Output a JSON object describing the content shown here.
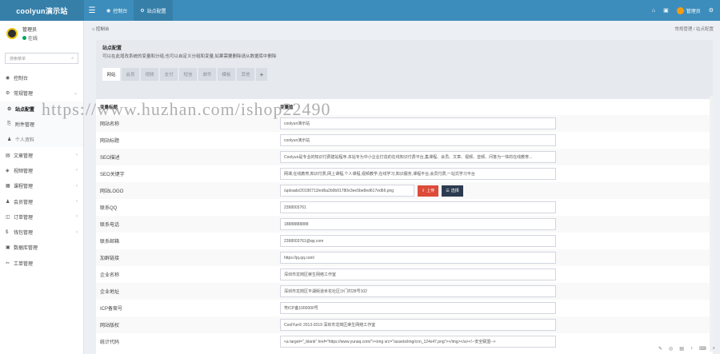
{
  "brand": "coolyun演示站",
  "topnav": [
    {
      "icon": "dashboard-icon",
      "label": "控制台",
      "active": false
    },
    {
      "icon": "gear-icon",
      "label": "站点配置",
      "active": true
    }
  ],
  "topright": {
    "user_name": "管理员"
  },
  "sidebar": {
    "user": {
      "name": "管理员",
      "status": "在线"
    },
    "search_placeholder": "搜索菜单",
    "items": [
      {
        "icon": "dashboard-icon",
        "label": "控制台",
        "type": "top"
      },
      {
        "icon": "cogs-icon",
        "label": "常规管理",
        "type": "top",
        "arrow": "⌄"
      },
      {
        "icon": "gear-icon",
        "label": "站点配置",
        "type": "sub active"
      },
      {
        "icon": "paperclip-icon",
        "label": "附件管理",
        "type": "sub"
      },
      {
        "icon": "user-icon",
        "label": "个人资料",
        "type": "sub dim"
      },
      {
        "icon": "book-icon",
        "label": "文章管理",
        "type": "top",
        "arrow": "‹"
      },
      {
        "icon": "bag-icon",
        "label": "视频管理",
        "type": "top",
        "arrow": "‹"
      },
      {
        "icon": "grid-icon",
        "label": "课程管理",
        "type": "top",
        "arrow": "‹"
      },
      {
        "icon": "users-icon",
        "label": "会员管理",
        "type": "top",
        "arrow": "‹"
      },
      {
        "icon": "cart-icon",
        "label": "订单管理",
        "type": "top",
        "arrow": "‹"
      },
      {
        "icon": "dollar-icon",
        "label": "钱包管理",
        "type": "top",
        "arrow": "‹"
      },
      {
        "icon": "database-icon",
        "label": "数据库管理",
        "type": "top"
      },
      {
        "icon": "tools-icon",
        "label": "工单管理",
        "type": "top"
      }
    ]
  },
  "breadcrumb": {
    "left": "控制台",
    "right": "常规管理 / 站点配置"
  },
  "box": {
    "title": "站点配置",
    "desc": "可以在此增改系统的变量和分组,也可以自定义分组和变量,如果需要删除请从数据库中删除",
    "tabs": [
      "网站",
      "会员",
      "视频",
      "支付",
      "短信",
      "邮件",
      "模板",
      "其他",
      "+"
    ],
    "header_label": "变量标题",
    "header_value": "变量值"
  },
  "rows": [
    {
      "label": "网站名称",
      "value": "coolyun演示站"
    },
    {
      "label": "网站标题",
      "value": "coolyun演示站"
    },
    {
      "label": "SEO描述",
      "value": "Coolyun是专业的知识付费建站程序,本站专为中小企业打造的在线知识付费平台,集课程、会员、文章、视频、音频、问答为一体的在线教育..."
    },
    {
      "label": "SEO关键字",
      "value": "网课,在线教育,知识付费,网上课程,个人课程,视频教学,在线学习,知识服务,课程平台,会员付费,一站式学习平台"
    },
    {
      "label": "网站LOGO",
      "value": "/uploads/20190713/ed6a2b0b91780e3ee5be8ed617ed66.png",
      "upload_label": "上传",
      "select_label": "选择"
    },
    {
      "label": "联系QQ",
      "value": "2398003761"
    },
    {
      "label": "联系电话",
      "value": "18888888888"
    },
    {
      "label": "联系邮箱",
      "value": "2398003761@qq.com"
    },
    {
      "label": "加群链接",
      "value": "https://jq.qq.com/"
    },
    {
      "label": "企业名称",
      "value": "深圳市龙岗区荣生网络工作室"
    },
    {
      "label": "企业地址",
      "value": "深圳市龙岗区平湖街道禾花社区沙门村28号102"
    },
    {
      "label": "ICP备案号",
      "value": "粤ICP备1000000号"
    },
    {
      "label": "网站版权",
      "value": "CoolYun© 2013-2019 深圳市龙岗区荣生网络工作室"
    },
    {
      "label": "统计代码",
      "value": "<a target=\"_blank\" href=\"https://www.yunaq.com/\"><img src=\"/assets/img/cnn_124x47.png\"></img></a><!--安全联盟-->"
    }
  ],
  "watermark": "https://www.huzhan.com/ishop22490"
}
